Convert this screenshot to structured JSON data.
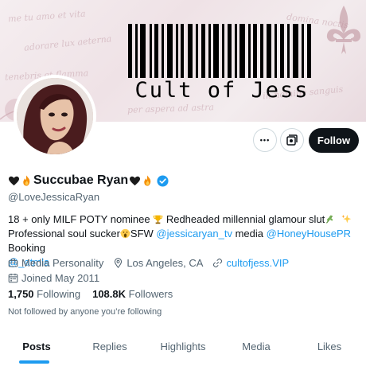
{
  "banner": {
    "title": "Cult of Jess",
    "script_lines": [
      "me tu amo et vita",
      "adorare lux aeterna",
      "tenebris et flamma",
      "in nomine sanguis",
      "per aspera ad astra",
      "domina noctis"
    ]
  },
  "header_actions": {
    "more_label": "•••",
    "follow_label": "Follow"
  },
  "profile": {
    "display_name": "Succubae Ryan",
    "handle": "@LoveJessicaRyan",
    "verified": true
  },
  "bio": {
    "line1_text": "18 + only MILF POTY nominee ",
    "line1_text2": " Redheaded millennial glamour slut",
    "line2_text": "Professional soul sucker",
    "line2_text2": "SFW ",
    "mention1": "@jessicaryan_tv",
    "line2_text3": " media ",
    "mention2": "@HoneyHousePR",
    "line2_text4": " Booking",
    "mention3": "@_atmla"
  },
  "meta": {
    "category": "Media Personality",
    "location": "Los Angeles, CA",
    "website": "cultofjess.VIP",
    "joined": "Joined May 2011"
  },
  "stats": {
    "following_count": "1,750",
    "following_label": "Following",
    "followers_count": "108.8K",
    "followers_label": "Followers"
  },
  "followed_by": "Not followed by anyone you’re following",
  "tabs": [
    {
      "label": "Posts",
      "active": true
    },
    {
      "label": "Replies",
      "active": false
    },
    {
      "label": "Highlights",
      "active": false
    },
    {
      "label": "Media",
      "active": false
    },
    {
      "label": "Likes",
      "active": false
    }
  ],
  "colors": {
    "accent": "#1d9bf0",
    "text": "#0f1419",
    "secondary_text": "#536471",
    "follow_button": "#0f1419"
  },
  "icons": {
    "heart": "black-heart-icon",
    "fire": "fire-icon",
    "verified": "verified-badge-icon",
    "trophy": "trophy-icon",
    "herb": "herb-icon",
    "sparkles": "sparkles-icon",
    "scream": "screaming-face-icon",
    "briefcase": "briefcase-icon",
    "location": "location-pin-icon",
    "link": "link-icon",
    "calendar": "calendar-icon",
    "subscribe": "subscribe-notifications-icon"
  }
}
